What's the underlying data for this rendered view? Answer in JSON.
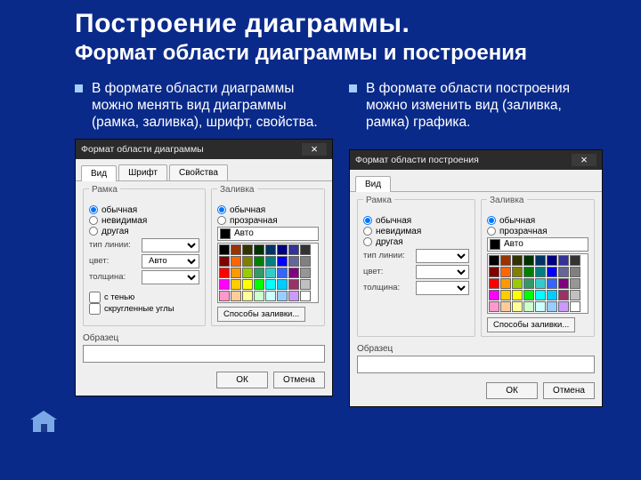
{
  "title": "Построение диаграммы.",
  "subtitle": "Формат области диаграммы и построения",
  "left": {
    "bullet": "В формате области диаграммы можно менять вид диаграммы (рамка, заливка), шрифт, свойства.",
    "dialog": {
      "title": "Формат области диаграммы",
      "close": "×",
      "tabs": [
        "Вид",
        "Шрифт",
        "Свойства"
      ],
      "frame_group": "Рамка",
      "frame_opts": [
        "обычная",
        "невидимая",
        "другая"
      ],
      "line_type": "тип линии:",
      "color_lbl": "цвет:",
      "color_auto": "Авто",
      "weight_lbl": "толщина:",
      "shadow": "с тенью",
      "rounded": "скругленные углы",
      "fill_group": "Заливка",
      "fill_opts": [
        "обычная",
        "прозрачная"
      ],
      "fill_effects": "Способы заливки...",
      "sample": "Образец",
      "ok": "ОК",
      "cancel": "Отмена",
      "auto_sw": "Авто"
    }
  },
  "right": {
    "bullet": "В формате области построения можно изменить вид (заливка, рамка) графика.",
    "dialog": {
      "title": "Формат области построения",
      "close": "×",
      "tabs": [
        "Вид"
      ],
      "frame_group": "Рамка",
      "frame_opts": [
        "обычная",
        "невидимая",
        "другая"
      ],
      "line_type": "тип линии:",
      "color_lbl": "цвет:",
      "weight_lbl": "толщина:",
      "fill_group": "Заливка",
      "fill_opts": [
        "обычная",
        "прозрачная"
      ],
      "fill_effects": "Способы заливки...",
      "sample": "Образец",
      "ok": "ОК",
      "cancel": "Отмена",
      "auto_sw": "Авто"
    }
  },
  "palette": [
    "#000000",
    "#993300",
    "#333300",
    "#003300",
    "#003366",
    "#000080",
    "#333399",
    "#333333",
    "#800000",
    "#FF6600",
    "#808000",
    "#008000",
    "#008080",
    "#0000FF",
    "#666699",
    "#808080",
    "#FF0000",
    "#FF9900",
    "#99CC00",
    "#339966",
    "#33CCCC",
    "#3366FF",
    "#800080",
    "#969696",
    "#FF00FF",
    "#FFCC00",
    "#FFFF00",
    "#00FF00",
    "#00FFFF",
    "#00CCFF",
    "#993366",
    "#C0C0C0",
    "#FF99CC",
    "#FFCC99",
    "#FFFF99",
    "#CCFFCC",
    "#CCFFFF",
    "#99CCFF",
    "#CC99FF",
    "#FFFFFF"
  ]
}
